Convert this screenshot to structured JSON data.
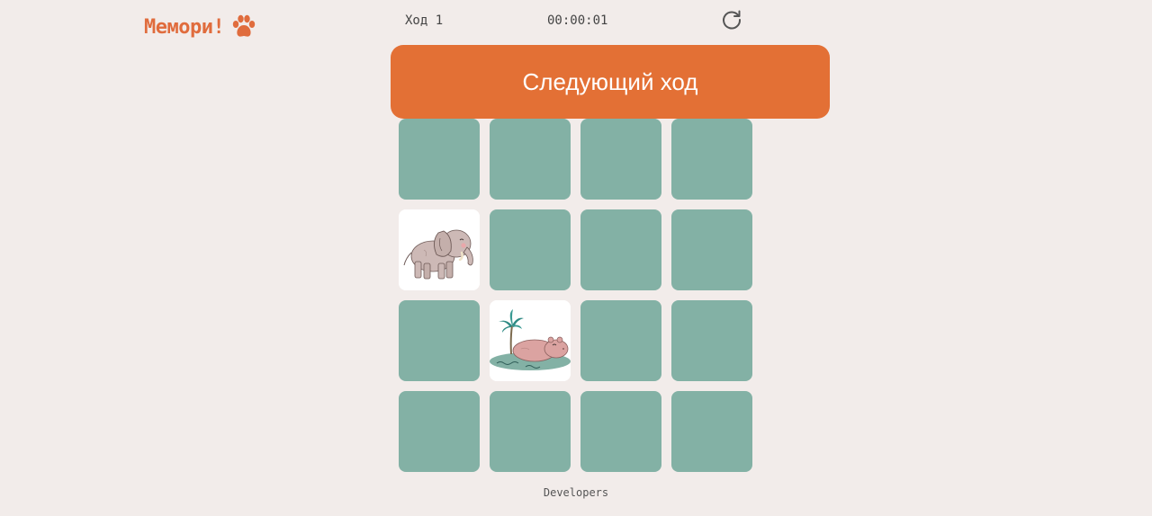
{
  "logo": {
    "text": "Мемори!",
    "icon": "paw-icon",
    "color": "#e06c3d"
  },
  "status": {
    "move_label": "Ход 1",
    "timer": "00:00:01",
    "restart_icon": "restart-icon"
  },
  "next_move_button": {
    "label": "Следующий ход",
    "color": "#e37035"
  },
  "board": {
    "rows": 4,
    "columns": 4,
    "card_back_color": "#83b1a5",
    "cards": [
      {
        "state": "closed"
      },
      {
        "state": "closed"
      },
      {
        "state": "closed"
      },
      {
        "state": "closed"
      },
      {
        "state": "open",
        "image": "elephant-icon"
      },
      {
        "state": "closed"
      },
      {
        "state": "closed"
      },
      {
        "state": "closed"
      },
      {
        "state": "closed"
      },
      {
        "state": "open",
        "image": "hippo-island-icon"
      },
      {
        "state": "closed"
      },
      {
        "state": "closed"
      },
      {
        "state": "closed"
      },
      {
        "state": "closed"
      },
      {
        "state": "closed"
      },
      {
        "state": "closed"
      }
    ]
  },
  "footer": {
    "link_label": "Developers"
  }
}
